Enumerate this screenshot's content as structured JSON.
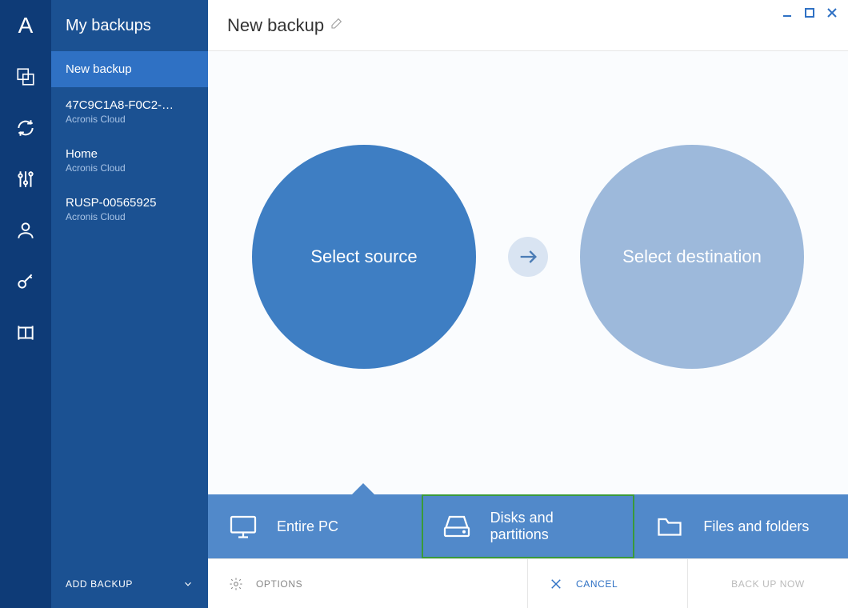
{
  "sidebar": {
    "header": "My backups",
    "items": [
      {
        "title": "New backup",
        "sub": ""
      },
      {
        "title": "47C9C1A8-F0C2-…",
        "sub": "Acronis Cloud"
      },
      {
        "title": "Home",
        "sub": "Acronis Cloud"
      },
      {
        "title": "RUSP-00565925",
        "sub": "Acronis Cloud"
      }
    ],
    "add_label": "ADD BACKUP"
  },
  "titlebar": {
    "title": "New backup"
  },
  "circles": {
    "source_label": "Select source",
    "destination_label": "Select destination"
  },
  "source_options": [
    {
      "label": "Entire PC"
    },
    {
      "label": "Disks and partitions"
    },
    {
      "label": "Files and folders"
    }
  ],
  "footer": {
    "options": "OPTIONS",
    "cancel": "CANCEL",
    "backup_now": "BACK UP NOW"
  },
  "icons": {
    "logo_letter": "A"
  }
}
